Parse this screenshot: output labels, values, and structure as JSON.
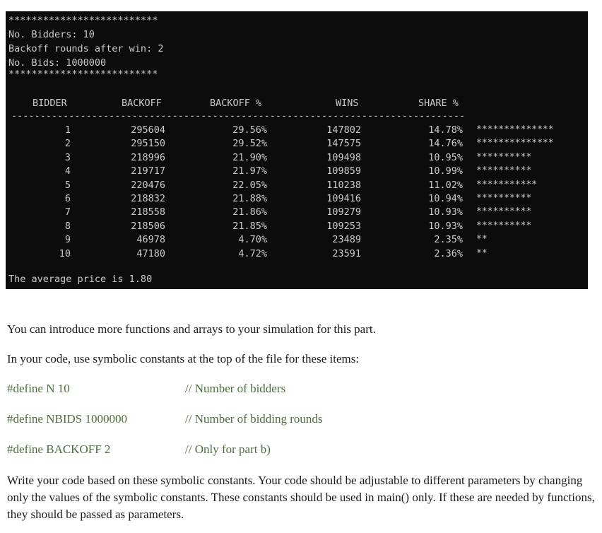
{
  "console": {
    "border_top": "**************************",
    "bidders_line": "No. Bidders: 10",
    "backoff_line": "Backoff rounds after win: 2",
    "bids_line": "No. Bids: 1000000",
    "border_bottom": "**************************",
    "headers": {
      "bidder": "BIDDER",
      "backoff": "BACKOFF",
      "backoff_pct": "BACKOFF %",
      "wins": "WINS",
      "share_pct": "SHARE %"
    },
    "divider": "----------------------------------------------------------------------------------------------",
    "rows": [
      {
        "bidder": "1",
        "backoff": "295604",
        "backoff_pct": "29.56%",
        "wins": "147802",
        "share_pct": "14.78%",
        "bar": "**************"
      },
      {
        "bidder": "2",
        "backoff": "295150",
        "backoff_pct": "29.52%",
        "wins": "147575",
        "share_pct": "14.76%",
        "bar": "**************"
      },
      {
        "bidder": "3",
        "backoff": "218996",
        "backoff_pct": "21.90%",
        "wins": "109498",
        "share_pct": "10.95%",
        "bar": "**********"
      },
      {
        "bidder": "4",
        "backoff": "219717",
        "backoff_pct": "21.97%",
        "wins": "109859",
        "share_pct": "10.99%",
        "bar": "**********"
      },
      {
        "bidder": "5",
        "backoff": "220476",
        "backoff_pct": "22.05%",
        "wins": "110238",
        "share_pct": "11.02%",
        "bar": "***********"
      },
      {
        "bidder": "6",
        "backoff": "218832",
        "backoff_pct": "21.88%",
        "wins": "109416",
        "share_pct": "10.94%",
        "bar": "**********"
      },
      {
        "bidder": "7",
        "backoff": "218558",
        "backoff_pct": "21.86%",
        "wins": "109279",
        "share_pct": "10.93%",
        "bar": "**********"
      },
      {
        "bidder": "8",
        "backoff": "218506",
        "backoff_pct": "21.85%",
        "wins": "109253",
        "share_pct": "10.93%",
        "bar": "**********"
      },
      {
        "bidder": "9",
        "backoff": "46978",
        "backoff_pct": "4.70%",
        "wins": "23489",
        "share_pct": "2.35%",
        "bar": "**"
      },
      {
        "bidder": "10",
        "backoff": "47180",
        "backoff_pct": "4.72%",
        "wins": "23591",
        "share_pct": "2.36%",
        "bar": "**"
      }
    ],
    "average_line": "The average price is 1.80"
  },
  "doc": {
    "para1": "You can introduce more functions and arrays to your simulation for this part.",
    "para2": "In your code, use symbolic constants at the top of the file for these items:",
    "defines": [
      {
        "code": "#define N 10",
        "comment": "// Number of bidders"
      },
      {
        "code": "#define NBIDS 1000000",
        "comment": "// Number of bidding rounds"
      },
      {
        "code": "#define BACKOFF 2",
        "comment": "// Only for part b)"
      }
    ],
    "para3": "Write your code based on these symbolic constants. Your code should be adjustable to different parameters by changing only the values of the symbolic constants. These constants should be used in main() only. If these are needed by functions, they should be passed as parameters."
  }
}
